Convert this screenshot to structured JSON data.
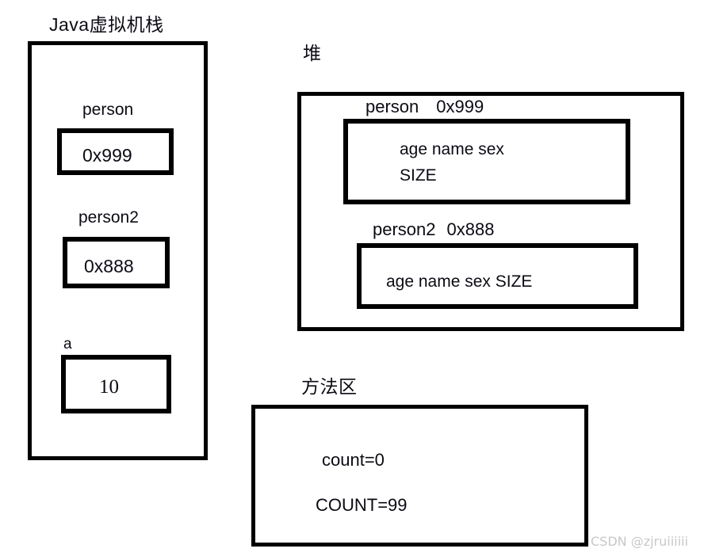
{
  "diagram": {
    "title_stack": "Java虚拟机栈",
    "title_heap": "堆",
    "title_method_area": "方法区",
    "stack": {
      "frames": [
        {
          "name": "person",
          "value": "0x999"
        },
        {
          "name": "person2",
          "value": "0x888"
        },
        {
          "name": "a",
          "value": "10"
        }
      ]
    },
    "heap": {
      "objects": [
        {
          "ref_name": "person",
          "address": "0x999",
          "fields_line1": "age   name    sex",
          "fields_line2": "SIZE"
        },
        {
          "ref_name": "person2",
          "address": "0x888",
          "fields_line1": "age   name    sex   SIZE",
          "fields_line2": ""
        }
      ]
    },
    "method_area": {
      "entries": [
        "count=0",
        "COUNT=99"
      ]
    },
    "watermark": "CSDN @zjruiiiiii",
    "colors": {
      "stroke": "#000000",
      "text": "#0b0b14",
      "background": "#ffffff",
      "watermark": "#c8c8c8"
    }
  }
}
